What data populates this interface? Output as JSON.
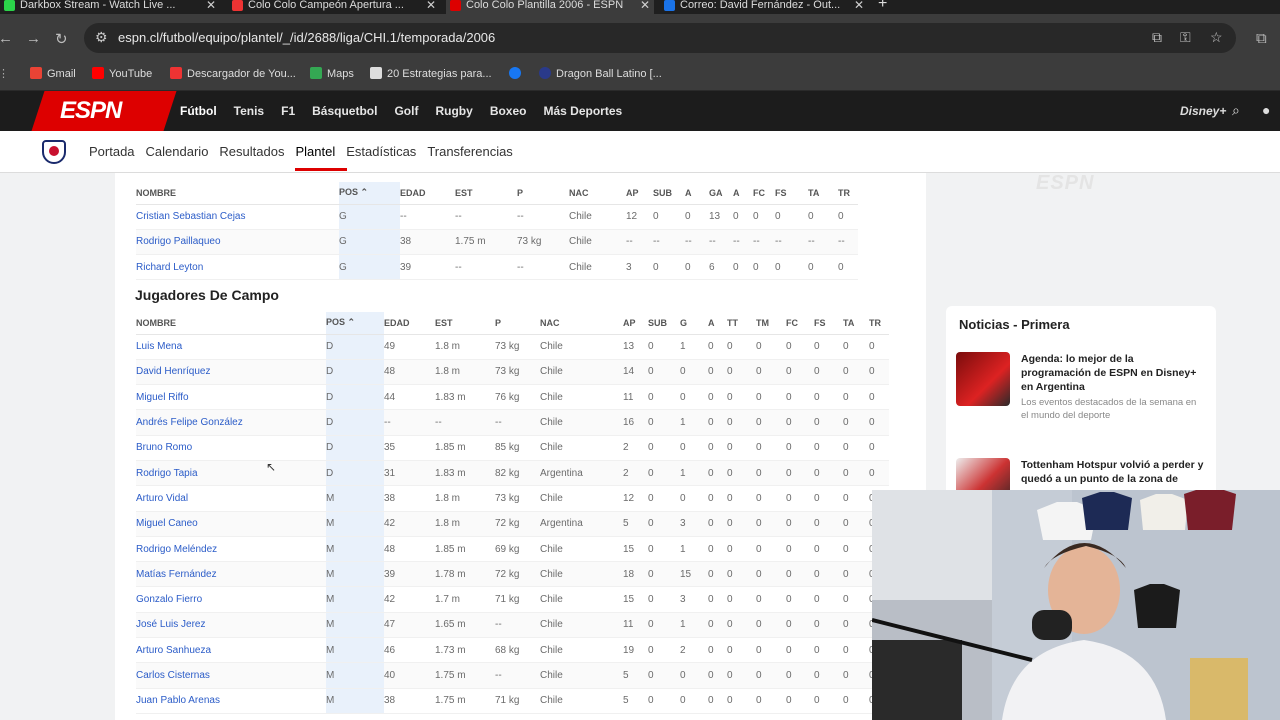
{
  "browser": {
    "tabs": [
      {
        "label": "Darkbox Stream - Watch Live ..."
      },
      {
        "label": "Colo Colo Campeón Apertura ..."
      },
      {
        "label": "Colo Colo Plantilla 2006 - ESPN"
      },
      {
        "label": "Correo: David Fernández - Out..."
      }
    ],
    "url": "espn.cl/futbol/equipo/plantel/_/id/2688/liga/CHI.1/temporada/2006",
    "bookmarks": [
      {
        "label": "Gmail"
      },
      {
        "label": "YouTube"
      },
      {
        "label": "Descargador de You..."
      },
      {
        "label": "Maps"
      },
      {
        "label": "20 Estrategias para..."
      },
      {
        "label": ""
      },
      {
        "label": "Dragon Ball Latino [..."
      }
    ]
  },
  "espn": {
    "logo": "ESPN",
    "nav": [
      "Fútbol",
      "Tenis",
      "F1",
      "Básquetbol",
      "Golf",
      "Rugby",
      "Boxeo",
      "Más Deportes"
    ],
    "subnav": [
      "Portada",
      "Calendario",
      "Resultados",
      "Plantel",
      "Estadísticas",
      "Transferencias"
    ]
  },
  "goalkeepers": {
    "headers": [
      "NOMBRE",
      "POS",
      "EDAD",
      "EST",
      "P",
      "NAC",
      "AP",
      "SUB",
      "A",
      "GA",
      "A",
      "FC",
      "FS",
      "TA",
      "TR"
    ],
    "rows": [
      [
        "Cristian Sebastian Cejas",
        "G",
        "--",
        "--",
        "--",
        "Chile",
        "12",
        "0",
        "0",
        "13",
        "0",
        "0",
        "0",
        "0",
        "0"
      ],
      [
        "Rodrigo Paillaqueo",
        "G",
        "38",
        "1.75 m",
        "73 kg",
        "Chile",
        "--",
        "--",
        "--",
        "--",
        "--",
        "--",
        "--",
        "--",
        "--"
      ],
      [
        "Richard Leyton",
        "G",
        "39",
        "--",
        "--",
        "Chile",
        "3",
        "0",
        "0",
        "6",
        "0",
        "0",
        "0",
        "0",
        "0"
      ]
    ]
  },
  "field_section_title": "Jugadores De Campo",
  "field_players": {
    "headers": [
      "NOMBRE",
      "POS",
      "EDAD",
      "EST",
      "P",
      "NAC",
      "AP",
      "SUB",
      "G",
      "A",
      "TT",
      "TM",
      "FC",
      "FS",
      "TA",
      "TR"
    ],
    "rows": [
      [
        "Luis Mena",
        "D",
        "49",
        "1.8 m",
        "73 kg",
        "Chile",
        "13",
        "0",
        "1",
        "0",
        "0",
        "0",
        "0",
        "0",
        "0",
        "0"
      ],
      [
        "David Henríquez",
        "D",
        "48",
        "1.8 m",
        "73 kg",
        "Chile",
        "14",
        "0",
        "0",
        "0",
        "0",
        "0",
        "0",
        "0",
        "0",
        "0"
      ],
      [
        "Miguel Riffo",
        "D",
        "44",
        "1.83 m",
        "76 kg",
        "Chile",
        "11",
        "0",
        "0",
        "0",
        "0",
        "0",
        "0",
        "0",
        "0",
        "0"
      ],
      [
        "Andrés Felipe González",
        "D",
        "--",
        "--",
        "--",
        "Chile",
        "16",
        "0",
        "1",
        "0",
        "0",
        "0",
        "0",
        "0",
        "0",
        "0"
      ],
      [
        "Bruno Romo",
        "D",
        "35",
        "1.85 m",
        "85 kg",
        "Chile",
        "2",
        "0",
        "0",
        "0",
        "0",
        "0",
        "0",
        "0",
        "0",
        "0"
      ],
      [
        "Rodrigo Tapia",
        "D",
        "31",
        "1.83 m",
        "82 kg",
        "Argentina",
        "2",
        "0",
        "1",
        "0",
        "0",
        "0",
        "0",
        "0",
        "0",
        "0"
      ],
      [
        "Arturo Vidal",
        "M",
        "38",
        "1.8 m",
        "73 kg",
        "Chile",
        "12",
        "0",
        "0",
        "0",
        "0",
        "0",
        "0",
        "0",
        "0",
        "0"
      ],
      [
        "Miguel Caneo",
        "M",
        "42",
        "1.8 m",
        "72 kg",
        "Argentina",
        "5",
        "0",
        "3",
        "0",
        "0",
        "0",
        "0",
        "0",
        "0",
        "0"
      ],
      [
        "Rodrigo Meléndez",
        "M",
        "48",
        "1.85 m",
        "69 kg",
        "Chile",
        "15",
        "0",
        "1",
        "0",
        "0",
        "0",
        "0",
        "0",
        "0",
        "0"
      ],
      [
        "Matías Fernández",
        "M",
        "39",
        "1.78 m",
        "72 kg",
        "Chile",
        "18",
        "0",
        "15",
        "0",
        "0",
        "0",
        "0",
        "0",
        "0",
        "0"
      ],
      [
        "Gonzalo Fierro",
        "M",
        "42",
        "1.7 m",
        "71 kg",
        "Chile",
        "15",
        "0",
        "3",
        "0",
        "0",
        "0",
        "0",
        "0",
        "0",
        "0"
      ],
      [
        "José Luis Jerez",
        "M",
        "47",
        "1.65 m",
        "--",
        "Chile",
        "11",
        "0",
        "1",
        "0",
        "0",
        "0",
        "0",
        "0",
        "0",
        "0"
      ],
      [
        "Arturo Sanhueza",
        "M",
        "46",
        "1.73 m",
        "68 kg",
        "Chile",
        "19",
        "0",
        "2",
        "0",
        "0",
        "0",
        "0",
        "0",
        "0",
        "0"
      ],
      [
        "Carlos Cisternas",
        "M",
        "40",
        "1.75 m",
        "--",
        "Chile",
        "5",
        "0",
        "0",
        "0",
        "0",
        "0",
        "0",
        "0",
        "0",
        "0"
      ],
      [
        "Juan Pablo Arenas",
        "M",
        "38",
        "1.75 m",
        "71 kg",
        "Chile",
        "5",
        "0",
        "0",
        "0",
        "0",
        "0",
        "0",
        "0",
        "0",
        "0"
      ]
    ]
  },
  "side_ad": "ESPN",
  "news": {
    "title": "Noticias - Primera",
    "items": [
      {
        "headline": "Agenda: lo mejor de la programación de ESPN en Disney+ en Argentina",
        "summary": "Los eventos destacados de la semana en el mundo del deporte"
      },
      {
        "headline": "Tottenham Hotspur volvió a perder y quedó a un punto de la zona de",
        "summary": ""
      }
    ]
  },
  "colors": {
    "espn_red": "#d00000",
    "link_blue": "#2b5cc8",
    "pos_highlight": "#e9f1fb"
  }
}
